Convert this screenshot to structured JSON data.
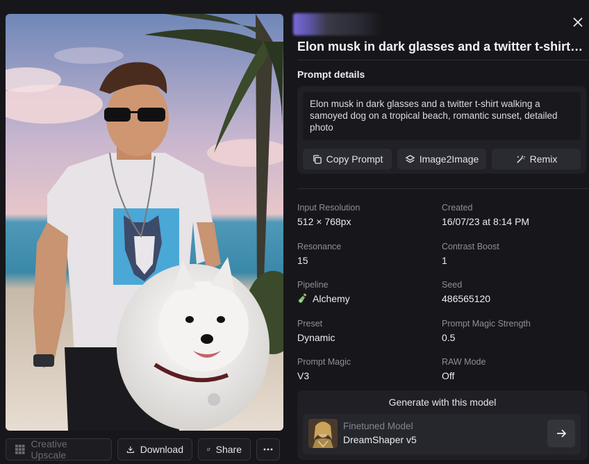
{
  "title": "Elon musk in dark glasses and a twitter t-shirt walking a samoyed dog on a tropical beach, romantic sunset, detailed photo",
  "prompt_details_label": "Prompt details",
  "prompt_text": "Elon musk in dark glasses and a twitter t-shirt walking a samoyed dog on a tropical beach, romantic sunset, detailed photo",
  "prompt_actions": {
    "copy": "Copy Prompt",
    "image2image": "Image2Image",
    "remix": "Remix"
  },
  "metadata": [
    {
      "label": "Input Resolution",
      "value": "512 × 768px"
    },
    {
      "label": "Created",
      "value": "16/07/23 at 8:14 PM"
    },
    {
      "label": "Resonance",
      "value": "15"
    },
    {
      "label": "Contrast Boost",
      "value": "1"
    },
    {
      "label": "Pipeline",
      "value": "Alchemy",
      "icon": "potion-icon"
    },
    {
      "label": "Seed",
      "value": "486565120"
    },
    {
      "label": "Preset",
      "value": "Dynamic"
    },
    {
      "label": "Prompt Magic Strength",
      "value": "0.5"
    },
    {
      "label": "Prompt Magic",
      "value": "V3"
    },
    {
      "label": "RAW Mode",
      "value": "Off"
    }
  ],
  "generate": {
    "title": "Generate with this model",
    "model_kind": "Finetuned Model",
    "model_name": "DreamShaper v5"
  },
  "bottom_actions": {
    "creative_upscale": "Creative Upscale",
    "download": "Download",
    "share": "Share"
  },
  "colors": {
    "background": "#17171b",
    "card": "#202026",
    "accent_avatar": "#7a6ad9"
  }
}
